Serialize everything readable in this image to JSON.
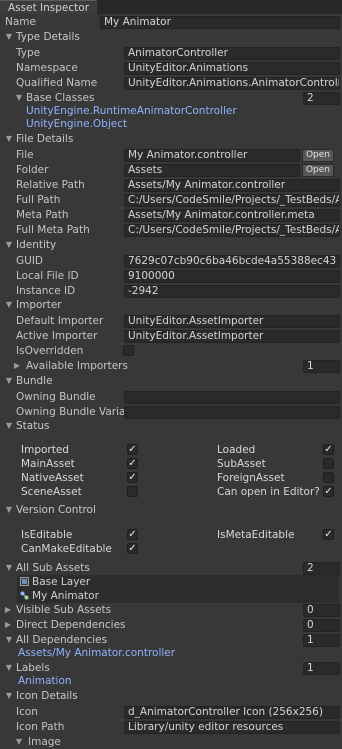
{
  "tab": "Asset Inspector",
  "name": {
    "label": "Name",
    "value": "My Animator"
  },
  "type_details": {
    "header": "Type Details",
    "type": {
      "label": "Type",
      "value": "AnimatorController"
    },
    "namespace": {
      "label": "Namespace",
      "value": "UnityEditor.Animations"
    },
    "qualified": {
      "label": "Qualified Name",
      "value": "UnityEditor.Animations.AnimatorController, Unit"
    },
    "base_classes": {
      "label": "Base Classes",
      "count": "2",
      "items": [
        "UnityEngine.RuntimeAnimatorController",
        "UnityEngine.Object"
      ]
    }
  },
  "file_details": {
    "header": "File Details",
    "file": {
      "label": "File",
      "value": "My Animator.controller",
      "button": "Open"
    },
    "folder": {
      "label": "Folder",
      "value": "Assets",
      "button": "Open"
    },
    "relative": {
      "label": "Relative Path",
      "value": "Assets/My Animator.controller"
    },
    "full": {
      "label": "Full Path",
      "value": "C:/Users/CodeSmile/Projects/_TestBeds/AssetI"
    },
    "meta": {
      "label": "Meta Path",
      "value": "Assets/My Animator.controller.meta"
    },
    "full_meta": {
      "label": "Full Meta Path",
      "value": "C:/Users/CodeSmile/Projects/_TestBeds/AssetI"
    }
  },
  "identity": {
    "header": "Identity",
    "guid": {
      "label": "GUID",
      "value": "7629c07cb90c6ba46bcde4a55388ec43"
    },
    "local": {
      "label": "Local File ID",
      "value": "9100000"
    },
    "instance": {
      "label": "Instance ID",
      "value": "-2942"
    }
  },
  "importer": {
    "header": "Importer",
    "default": {
      "label": "Default Importer",
      "value": "UnityEditor.AssetImporter"
    },
    "active": {
      "label": "Active Importer",
      "value": "UnityEditor.AssetImporter"
    },
    "overridden": {
      "label": "IsOverridden",
      "checked": false
    },
    "available": {
      "label": "Available Importers",
      "count": "1"
    }
  },
  "bundle": {
    "header": "Bundle",
    "owning": {
      "label": "Owning Bundle",
      "value": ""
    },
    "variant": {
      "label": "Owning Bundle Variant",
      "value": ""
    }
  },
  "status": {
    "header": "Status",
    "items": [
      {
        "label": "Imported",
        "checked": true
      },
      {
        "label": "Loaded",
        "checked": true
      },
      {
        "label": "MainAsset",
        "checked": true
      },
      {
        "label": "SubAsset",
        "checked": false
      },
      {
        "label": "NativeAsset",
        "checked": true
      },
      {
        "label": "ForeignAsset",
        "checked": false
      },
      {
        "label": "SceneAsset",
        "checked": false
      },
      {
        "label": "Can open in Editor?",
        "checked": true
      }
    ]
  },
  "version_control": {
    "header": "Version Control",
    "items": [
      {
        "label": "IsEditable",
        "checked": true
      },
      {
        "label": "IsMetaEditable",
        "checked": true
      },
      {
        "label": "CanMakeEditable",
        "checked": true
      }
    ]
  },
  "sub_assets": {
    "label": "All Sub Assets",
    "count": "2",
    "items": [
      "Base Layer",
      "My Animator"
    ]
  },
  "visible_sub": {
    "label": "Visible Sub Assets",
    "count": "0"
  },
  "direct_deps": {
    "label": "Direct Dependencies",
    "count": "0"
  },
  "all_deps": {
    "label": "All Dependencies",
    "count": "1",
    "items": [
      "Assets/My Animator.controller"
    ]
  },
  "labels": {
    "label": "Labels",
    "count": "1",
    "items": [
      "Animation"
    ]
  },
  "icon_details": {
    "header": "Icon Details",
    "icon": {
      "label": "Icon",
      "value": "d_AnimatorController Icon (256x256)"
    },
    "path": {
      "label": "Icon Path",
      "value": "Library/unity editor resources"
    },
    "image": {
      "label": "Image"
    }
  },
  "icons": {
    "fold_open": "▼",
    "fold_closed": "▶",
    "check": "✓"
  }
}
